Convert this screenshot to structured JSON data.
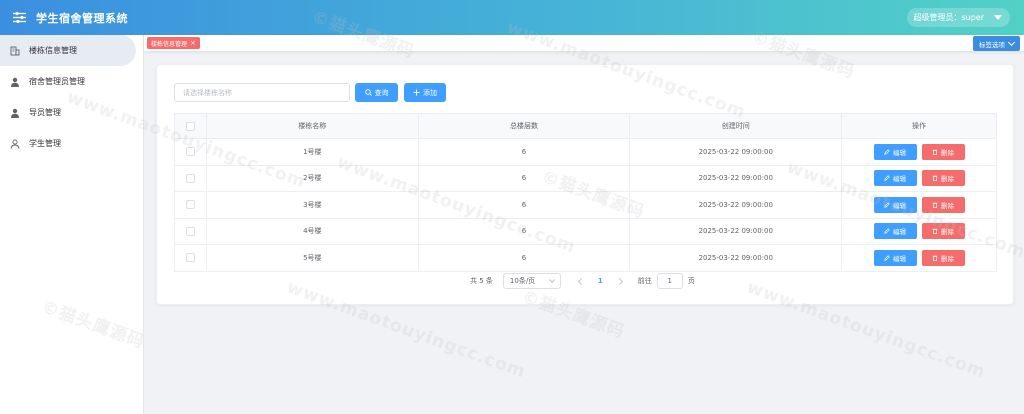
{
  "header": {
    "title": "学生宿舍管理系统",
    "user_label": "超级管理员：super"
  },
  "sidebar": {
    "items": [
      {
        "label": "楼栋信息管理",
        "icon": "building-icon",
        "active": true
      },
      {
        "label": "宿舍管理员管理",
        "icon": "user-icon",
        "active": false
      },
      {
        "label": "导员管理",
        "icon": "user-icon",
        "active": false
      },
      {
        "label": "学生管理",
        "icon": "user-outline-icon",
        "active": false
      }
    ]
  },
  "tags": {
    "active_tag": "楼栋信息管理",
    "options_label": "标签选项"
  },
  "toolbar": {
    "search_placeholder": "请选择楼栋名称",
    "search_label": "查询",
    "add_label": "添加"
  },
  "table": {
    "columns": [
      "楼栋名称",
      "总楼层数",
      "创建时间",
      "操作"
    ],
    "rows": [
      {
        "name": "1号楼",
        "floors": "6",
        "created": "2025-03-22 09:00:00"
      },
      {
        "name": "2号楼",
        "floors": "6",
        "created": "2025-03-22 09:00:00"
      },
      {
        "name": "3号楼",
        "floors": "6",
        "created": "2025-03-22 09:00:00"
      },
      {
        "name": "4号楼",
        "floors": "6",
        "created": "2025-03-22 09:00:00"
      },
      {
        "name": "5号楼",
        "floors": "6",
        "created": "2025-03-22 09:00:00"
      }
    ],
    "edit_label": "编辑",
    "delete_label": "删除"
  },
  "pagination": {
    "total": "共 5 条",
    "page_size": "10条/页",
    "current": "1",
    "goto_label": "前往",
    "goto_value": "1",
    "page_unit": "页"
  },
  "colors": {
    "primary": "#409eff",
    "danger": "#f56c6c",
    "header_start": "#3b8fe0",
    "header_end": "#52d1c6"
  }
}
